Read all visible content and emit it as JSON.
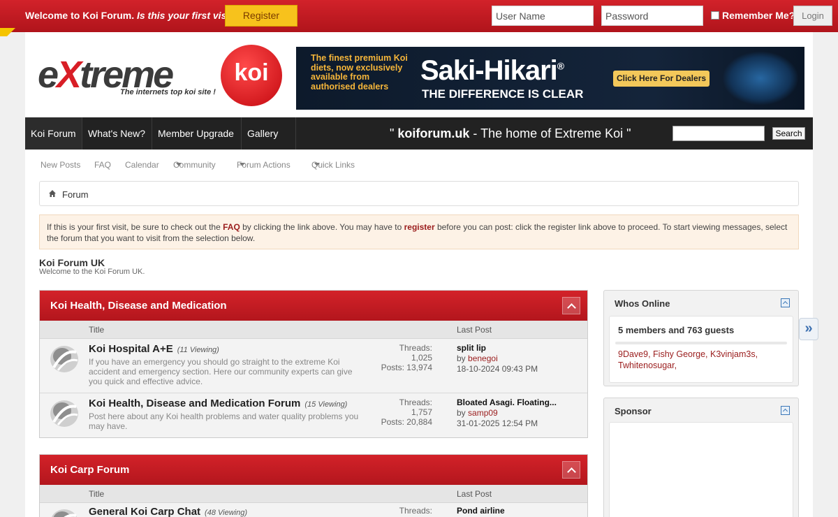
{
  "topbar": {
    "welcome": "Welcome to Koi Forum.",
    "first_visit": "Is this your first visit?",
    "register_label": "Register",
    "username_placeholder": "User Name",
    "password_placeholder": "Password",
    "remember_label": "Remember Me?",
    "login_label": "Login"
  },
  "logo": {
    "word_e": "e",
    "word_x": "X",
    "word_rest": "treme",
    "circle": "koi",
    "tagline": "The internets top koi site !"
  },
  "banner": {
    "lead": "The finest premium Koi diets, now exclusively available from authorised dealers",
    "brand": "Saki-Hikari",
    "brand_mark": "®",
    "sub": "THE DIFFERENCE IS CLEAR",
    "cta": "Click Here For Dealers"
  },
  "nav": {
    "tabs": [
      "Koi Forum",
      "What's New?",
      "Member Upgrade",
      "Gallery"
    ],
    "tagline_prefix": "\" ",
    "tagline_site": "koiforum.uk",
    "tagline_suffix": " - The home of Extreme Koi \"",
    "search_label": "Search"
  },
  "subnav": {
    "items": [
      "New Posts",
      "FAQ",
      "Calendar",
      "Community",
      "Forum Actions",
      "Quick Links"
    ]
  },
  "breadcrumb": {
    "label": "Forum"
  },
  "notice": {
    "t1": "If this is your first visit, be sure to check out the ",
    "faq": "FAQ",
    "t2": " by clicking the link above. You may have to ",
    "register": "register",
    "t3": " before you can post: click the register link above to proceed. To start viewing messages, select the forum that you want to visit from the selection below."
  },
  "forum": {
    "title": "Koi Forum UK",
    "subtitle": "Welcome to the Koi Forum UK."
  },
  "columns": {
    "title": "Title",
    "last_post": "Last Post"
  },
  "categories": [
    {
      "name": "Koi Health, Disease and Medication",
      "forums": [
        {
          "name": "Koi Hospital A+E",
          "viewing": "(11 Viewing)",
          "desc": "If you have an emergency you should go straight to the extreme Koi accident and emergency section. Here our community experts can give you quick and effective advice.",
          "threads_label": "Threads:",
          "threads": "1,025",
          "posts_label": "Posts:",
          "posts": "13,974",
          "last_title": "split lip",
          "by": "by",
          "last_user": "benegoi",
          "last_date": "18-10-2024 09:43 PM"
        },
        {
          "name": "Koi Health, Disease and Medication Forum",
          "viewing": "(15 Viewing)",
          "desc": "Post here about any Koi health problems and water quality problems you may have.",
          "threads_label": "Threads:",
          "threads": "1,757",
          "posts_label": "Posts:",
          "posts": "20,884",
          "last_title": "Bloated Asagi. Floating...",
          "by": "by",
          "last_user": "samp09",
          "last_date": "31-01-2025 12:54 PM"
        }
      ]
    },
    {
      "name": "Koi Carp Forum",
      "forums": [
        {
          "name": "General Koi Carp Chat",
          "viewing": "(48 Viewing)",
          "threads_label": "Threads:",
          "last_title": "Pond airline"
        }
      ]
    }
  ],
  "sidebar": {
    "online": {
      "title": "Whos Online",
      "count": "5 members and 763 guests",
      "users": "9Dave9, Fishy George, K3vinjam3s, Twhitenosugar,"
    },
    "sponsor": {
      "title": "Sponsor"
    }
  },
  "side_arrow": "»"
}
